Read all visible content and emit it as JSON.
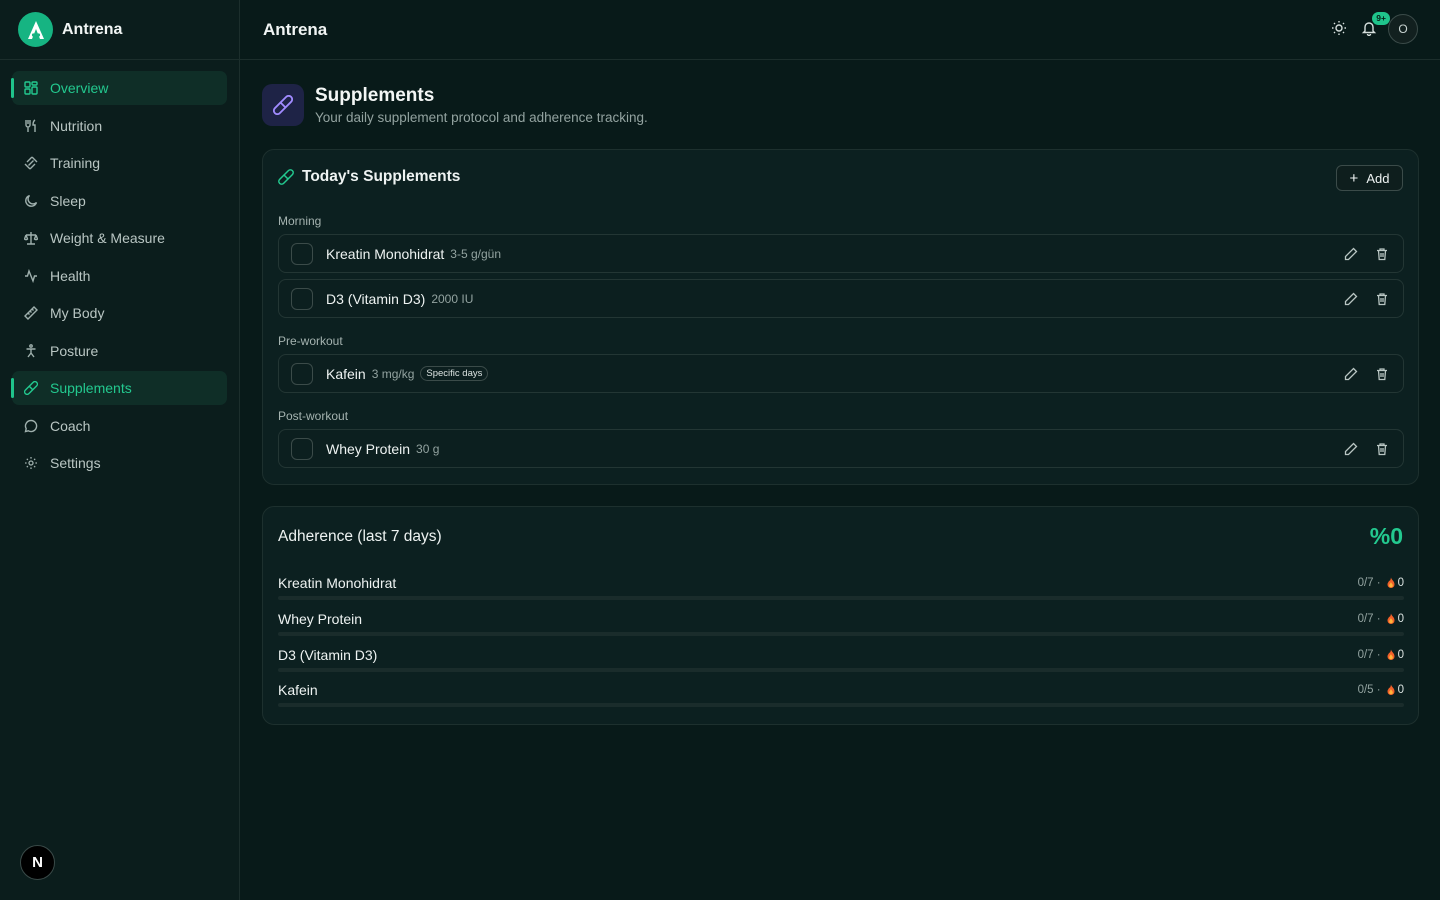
{
  "app": {
    "name": "Antrena",
    "header_title": "Antrena"
  },
  "theme": {
    "accent": "#1fc48b",
    "background": "#081a19",
    "page_icon_bg": "#1e2346"
  },
  "sidebar": {
    "items": [
      {
        "label": "Overview",
        "icon": "grid-icon",
        "active": true
      },
      {
        "label": "Nutrition",
        "icon": "utensils-icon"
      },
      {
        "label": "Training",
        "icon": "dumbbell-icon"
      },
      {
        "label": "Sleep",
        "icon": "moon-icon"
      },
      {
        "label": "Weight & Measure",
        "icon": "scale-icon"
      },
      {
        "label": "Health",
        "icon": "activity-icon"
      },
      {
        "label": "My Body",
        "icon": "ruler-icon"
      },
      {
        "label": "Posture",
        "icon": "person-icon"
      },
      {
        "label": "Supplements",
        "icon": "pill-icon",
        "active": true
      },
      {
        "label": "Coach",
        "icon": "message-icon"
      },
      {
        "label": "Settings",
        "icon": "gear-icon"
      }
    ],
    "footer_badge": "N"
  },
  "topbar": {
    "notification_count": "9+",
    "avatar_initial": "O"
  },
  "page": {
    "title": "Supplements",
    "subtitle": "Your daily supplement protocol and adherence tracking."
  },
  "today": {
    "title": "Today's Supplements",
    "add_label": "Add",
    "groups": [
      {
        "label": "Morning",
        "items": [
          {
            "name": "Kreatin Monohidrat",
            "dose": "3-5 g/gün",
            "checked": false
          },
          {
            "name": "D3 (Vitamin D3)",
            "dose": "2000 IU",
            "checked": false
          }
        ]
      },
      {
        "label": "Pre-workout",
        "items": [
          {
            "name": "Kafein",
            "dose": "3 mg/kg",
            "tag": "Specific days",
            "checked": false
          }
        ]
      },
      {
        "label": "Post-workout",
        "items": [
          {
            "name": "Whey Protein",
            "dose": "30 g",
            "checked": false
          }
        ]
      }
    ]
  },
  "adherence": {
    "title": "Adherence (last 7 days)",
    "total": "%0",
    "items": [
      {
        "name": "Kreatin Monohidrat",
        "stat": "0/7 ·",
        "streak": "0",
        "progress": 0
      },
      {
        "name": "Whey Protein",
        "stat": "0/7 ·",
        "streak": "0",
        "progress": 0
      },
      {
        "name": "D3 (Vitamin D3)",
        "stat": "0/7 ·",
        "streak": "0",
        "progress": 0
      },
      {
        "name": "Kafein",
        "stat": "0/5 ·",
        "streak": "0",
        "progress": 0
      }
    ]
  }
}
